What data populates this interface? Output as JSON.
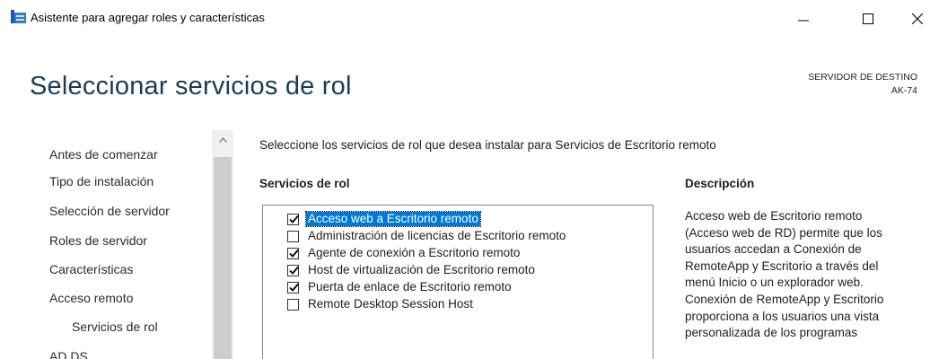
{
  "window": {
    "title": "Asistente para agregar roles y características",
    "controls": {
      "minimize": "—",
      "maximize": "☐",
      "close": "✕"
    }
  },
  "header": {
    "title": "Seleccionar servicios de rol",
    "destination_label": "SERVIDOR DE DESTINO",
    "destination_server": "AK-74"
  },
  "nav": {
    "items": [
      {
        "label": "Antes de comenzar",
        "level": 0
      },
      {
        "label": "Tipo de instalación",
        "level": 0
      },
      {
        "label": "Selección de servidor",
        "level": 0
      },
      {
        "label": "Roles de servidor",
        "level": 0
      },
      {
        "label": "Características",
        "level": 0
      },
      {
        "label": "Acceso remoto",
        "level": 0
      },
      {
        "label": "Servicios de rol",
        "level": 1
      },
      {
        "label": "AD DS",
        "level": 0
      }
    ]
  },
  "main": {
    "instruction": "Seleccione los servicios de rol que desea instalar para Servicios de Escritorio remoto",
    "roles_header": "Servicios de rol",
    "description_header": "Descripción",
    "roles": [
      {
        "label": "Acceso web a Escritorio remoto",
        "checked": true,
        "selected": true
      },
      {
        "label": "Administración de licencias de Escritorio remoto",
        "checked": false,
        "selected": false
      },
      {
        "label": "Agente de conexión a Escritorio remoto",
        "checked": true,
        "selected": false
      },
      {
        "label": "Host de virtualización de Escritorio remoto",
        "checked": true,
        "selected": false
      },
      {
        "label": "Puerta de enlace de Escritorio remoto",
        "checked": true,
        "selected": false
      },
      {
        "label": "Remote Desktop Session Host",
        "checked": false,
        "selected": false
      }
    ],
    "description_lines": [
      "Acceso web de Escritorio remoto",
      "(Acceso web de RD) permite que los",
      "usuarios accedan a Conexión de",
      "RemoteApp y Escritorio a través del",
      "menú Inicio o un explorador web.",
      "Conexión de RemoteApp y Escritorio",
      "proporciona a los usuarios una vista",
      "personalizada de los programas"
    ]
  },
  "colors": {
    "title_color": "#1a3c57",
    "selection": "#0078d7"
  }
}
